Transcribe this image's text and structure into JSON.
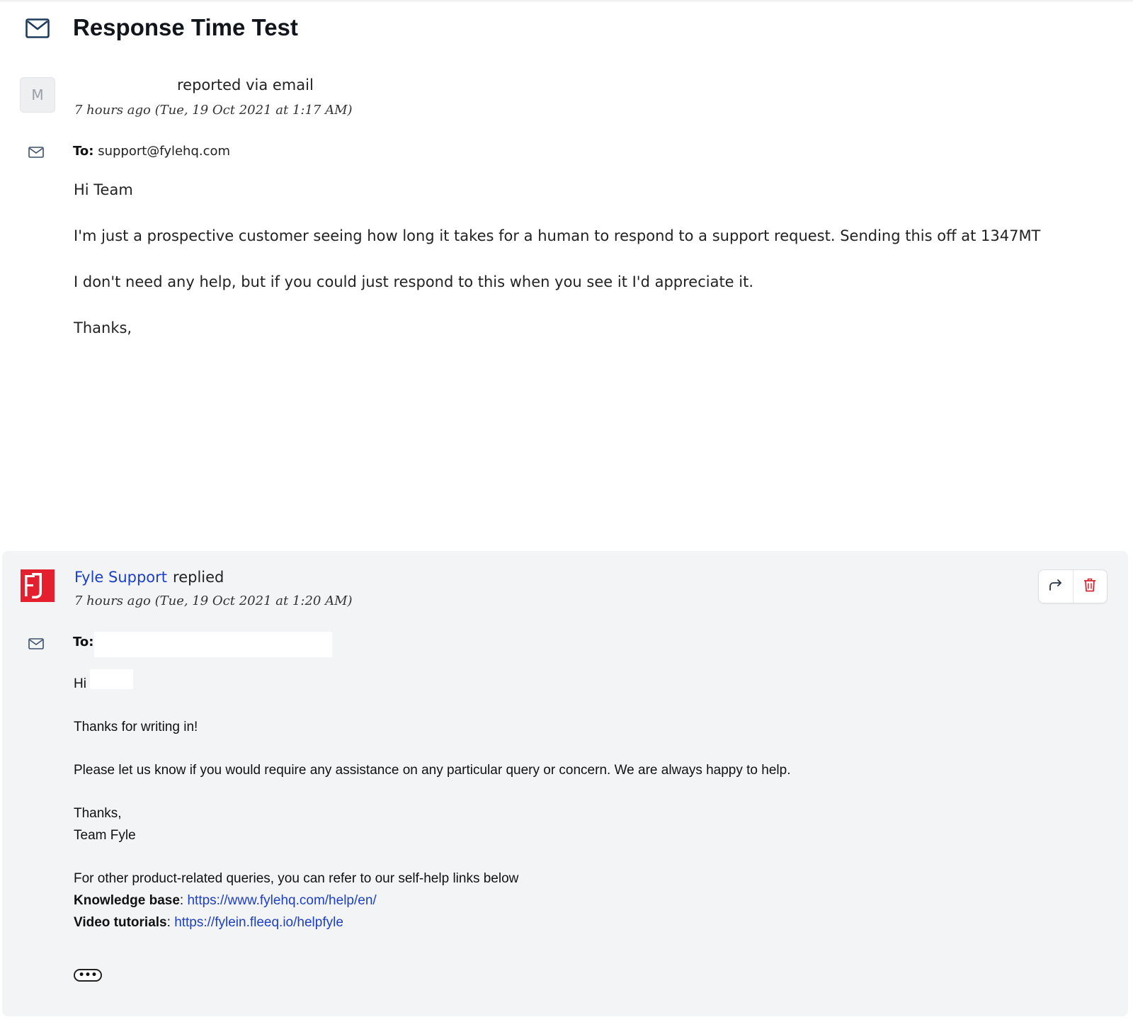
{
  "ticket": {
    "title": "Response Time Test"
  },
  "messages": [
    {
      "avatar_initial": "M",
      "action_text": "reported via email",
      "timestamp": "7 hours ago (Tue, 19 Oct 2021 at 1:17 AM)",
      "to_label": "To:",
      "to_value": "support@fylehq.com",
      "body": [
        "Hi Team",
        "I'm just a prospective customer seeing how long it takes for a human to respond to a support request. Sending this off at 1347MT",
        "I don't need any help, but if you could just respond to this when you see it I'd appreciate it.",
        "Thanks,"
      ]
    },
    {
      "sender_name": "Fyle Support",
      "action_text": "replied",
      "timestamp": "7 hours ago (Tue, 19 Oct 2021 at 1:20 AM)",
      "to_label": "To:",
      "greeting": "Hi",
      "body_thanks_writing": "Thanks for writing in!",
      "body_assist": "Please let us know if you would require any assistance on any particular query or concern. We are always happy to help.",
      "sign_thanks": "Thanks,",
      "sign_team": "Team Fyle",
      "selfhelp_intro": "For other product-related queries, you can refer to our self-help links below",
      "kb_label": "Knowledge base",
      "kb_link": "https://www.fylehq.com/help/en/",
      "video_label": "Video tutorials",
      "video_link": "https://fylein.fleeq.io/helpfyle",
      "separator": ": ",
      "more_label": "•••",
      "accent_color": "#1d3ec6",
      "logo_color": "#e5202e",
      "delete_color": "#d9252f"
    }
  ],
  "icons": {
    "title": "mail-icon",
    "message_type": "envelope-icon",
    "forward": "forward-arrow-icon",
    "delete": "trash-icon",
    "logo": "fyle-logo-icon"
  }
}
